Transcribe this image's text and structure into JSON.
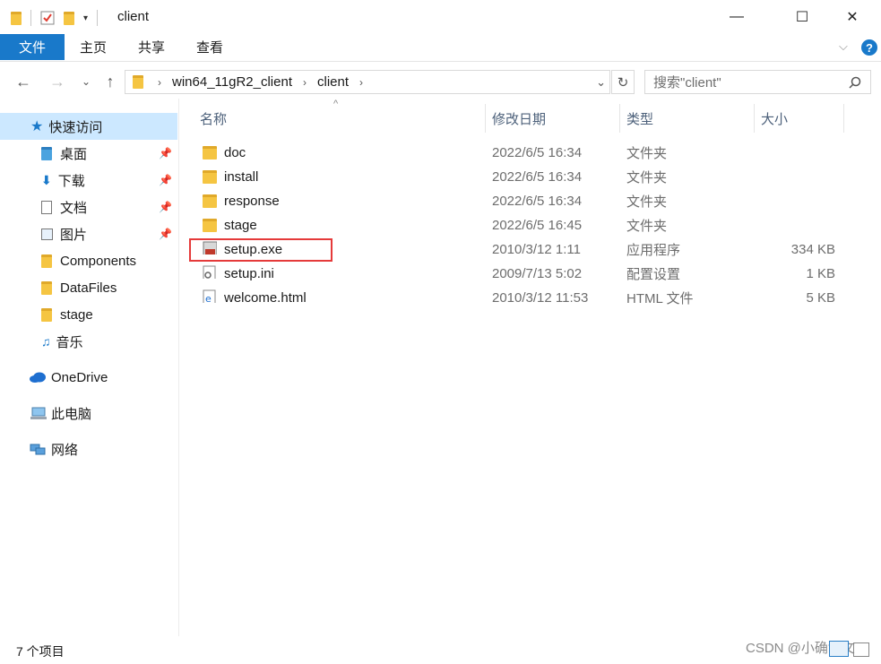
{
  "window": {
    "title": "client",
    "controls": {
      "minimize": "—",
      "maximize": "☐",
      "close": "✕"
    }
  },
  "ribbon": {
    "tabs": [
      "文件",
      "主页",
      "共享",
      "查看"
    ],
    "help": "?"
  },
  "address": {
    "path": [
      "win64_11gR2_client",
      "client"
    ],
    "search_placeholder": "搜索\"client\""
  },
  "nav": {
    "quick_access": "快速访问",
    "pinned": [
      {
        "label": "桌面",
        "icon": "desktop-icon"
      },
      {
        "label": "下载",
        "icon": "download-icon"
      },
      {
        "label": "文档",
        "icon": "documents-icon"
      },
      {
        "label": "图片",
        "icon": "pictures-icon"
      }
    ],
    "recent": [
      {
        "label": "Components",
        "icon": "folder-icon"
      },
      {
        "label": "DataFiles",
        "icon": "folder-icon"
      },
      {
        "label": "stage",
        "icon": "folder-icon"
      },
      {
        "label": "音乐",
        "icon": "music-icon"
      }
    ],
    "onedrive": "OneDrive",
    "this_pc": "此电脑",
    "network": "网络"
  },
  "columns": {
    "name": "名称",
    "date": "修改日期",
    "type": "类型",
    "size": "大小"
  },
  "files": [
    {
      "name": "doc",
      "date": "2022/6/5 16:34",
      "type": "文件夹",
      "size": "",
      "icon": "folder-icon"
    },
    {
      "name": "install",
      "date": "2022/6/5 16:34",
      "type": "文件夹",
      "size": "",
      "icon": "folder-icon"
    },
    {
      "name": "response",
      "date": "2022/6/5 16:34",
      "type": "文件夹",
      "size": "",
      "icon": "folder-icon"
    },
    {
      "name": "stage",
      "date": "2022/6/5 16:45",
      "type": "文件夹",
      "size": "",
      "icon": "folder-icon"
    },
    {
      "name": "setup.exe",
      "date": "2010/3/12 1:11",
      "type": "应用程序",
      "size": "334 KB",
      "icon": "exe-icon"
    },
    {
      "name": "setup.ini",
      "date": "2009/7/13 5:02",
      "type": "配置设置",
      "size": "1 KB",
      "icon": "ini-icon"
    },
    {
      "name": "welcome.html",
      "date": "2010/3/12 11:53",
      "type": "HTML 文件",
      "size": "5 KB",
      "icon": "edge-html-icon"
    }
  ],
  "status": {
    "item_count": "7 个项目"
  },
  "watermark": "CSDN @小确博文",
  "colors": {
    "accent": "#1979ca",
    "selection": "#cce8ff",
    "highlight": "#e53a3a",
    "folder": "#f5c542"
  }
}
